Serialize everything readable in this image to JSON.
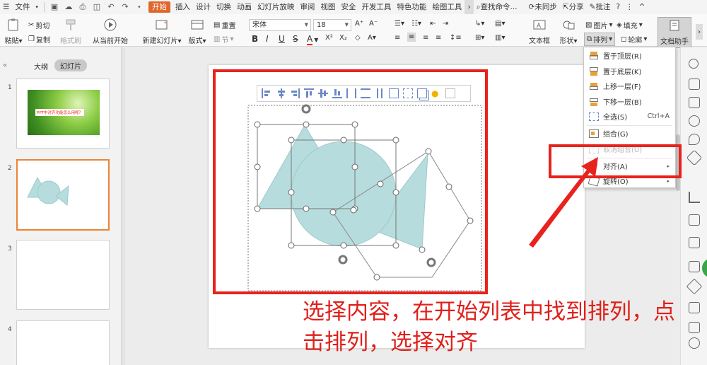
{
  "menubar": {
    "file_label": "文件",
    "tabs": [
      "开始",
      "插入",
      "设计",
      "切换",
      "动画",
      "幻灯片放映",
      "审阅",
      "视图",
      "安全",
      "开发工具",
      "特色功能",
      "绘图工具"
    ],
    "search_label": "查找命令...",
    "sync_label": "未同步",
    "share_label": "分享",
    "comment_label": "批注",
    "help_label": "?"
  },
  "ribbon": {
    "paste_label": "粘贴",
    "cut_label": "剪切",
    "copy_label": "复制",
    "format_painter_label": "格式刷",
    "from_current_label": "从当前开始",
    "new_slide_label": "新建幻灯片",
    "layout_label": "版式",
    "reset_label": "重置",
    "section_label": "节",
    "font_name": "宋体",
    "font_size": "18",
    "textbox_label": "文本框",
    "shape_label": "形状",
    "picture_label": "图片",
    "fill_label": "填充",
    "arrange_label": "排列",
    "outline_label": "轮廓",
    "doc_assistant_label": "文档助手"
  },
  "leftpanel": {
    "tab_outline": "大纲",
    "tab_slides": "幻灯片",
    "slides": [
      {
        "num": "1",
        "title": "PPT中对齐功能怎么用呢？"
      },
      {
        "num": "2",
        "title": ""
      },
      {
        "num": "3",
        "title": ""
      },
      {
        "num": "4",
        "title": ""
      }
    ]
  },
  "dropdown": {
    "items": [
      {
        "label": "置于顶层(R)",
        "shortcut": ""
      },
      {
        "label": "置于底层(K)",
        "shortcut": ""
      },
      {
        "label": "上移一层(F)",
        "shortcut": ""
      },
      {
        "label": "下移一层(B)",
        "shortcut": ""
      },
      {
        "label": "全选(S)",
        "shortcut": "Ctrl+A"
      },
      {
        "label": "组合(G)",
        "shortcut": ""
      },
      {
        "label": "取消组合(U)",
        "shortcut": ""
      },
      {
        "label": "对齐(A)",
        "shortcut": ""
      },
      {
        "label": "旋转(O)",
        "shortcut": ""
      }
    ]
  },
  "annotation": {
    "caption_line1": "选择内容，在开始列表中找到排列，点",
    "caption_line2": "击排列，选择对齐"
  },
  "colors": {
    "accent": "#e0662c",
    "shape_fill": "#b7dcdd",
    "annotation_red": "#e8221c"
  }
}
